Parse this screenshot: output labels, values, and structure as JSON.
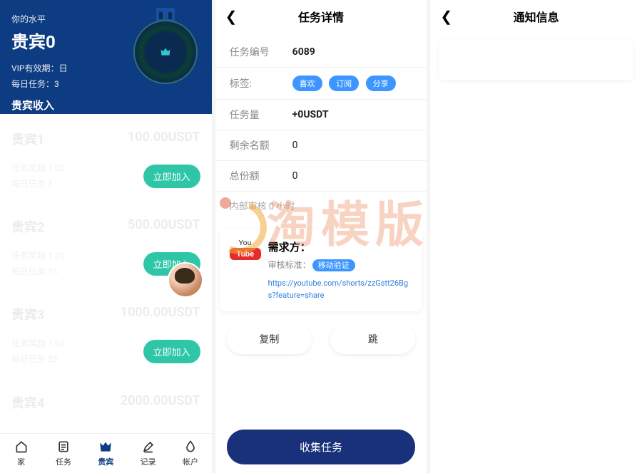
{
  "left": {
    "level_label": "你的水平",
    "level_name": "贵宾0",
    "vip_expiry_label": "VIP有效期：",
    "vip_expiry_value": "日",
    "daily_task_label": "每日任务：",
    "daily_task_value": "3",
    "income_label": "贵宾收入",
    "cards": [
      {
        "name": "贵宾1",
        "price": "100.00USDT",
        "row_a": "任务奖励  1.00",
        "row_b": "每日任务  3",
        "btn": "立即加入"
      },
      {
        "name": "贵宾2",
        "price": "500.00USDT",
        "row_a": "任务奖励  1.20",
        "row_b": "每日任务  15",
        "btn": "立即加入"
      },
      {
        "name": "贵宾3",
        "price": "1000.00USDT",
        "row_a": "任务奖励  1.60",
        "row_b": "每日任务  25",
        "btn": "立即加入"
      },
      {
        "name": "贵宾4",
        "price": "2000.00USDT",
        "row_a": "",
        "row_b": "",
        "btn": ""
      }
    ],
    "tabs": [
      {
        "label": "家"
      },
      {
        "label": "任务"
      },
      {
        "label": "贵宾"
      },
      {
        "label": "记录"
      },
      {
        "label": "帐户"
      }
    ]
  },
  "mid": {
    "title": "任务详情",
    "rows": {
      "id_k": "任务编号",
      "id_v": "6089",
      "tag_k": "标签:",
      "tags": [
        "喜欢",
        "订阅",
        "分享"
      ],
      "amt_k": "任务量",
      "amt_v": "+0USDT",
      "left_k": "剩余名额",
      "left_v": "0",
      "total_k": "总份额",
      "total_v": "0"
    },
    "note": "内部审核 0 小时",
    "req": {
      "yt_top": "You",
      "yt_box": "Tube",
      "title": "需求方：",
      "sub_label": "审核标准：",
      "sub_pill": "移动验证",
      "link": "https://youtube.com/shorts/zzGstt26Bgs?feature=share"
    },
    "btn_copy": "复制",
    "btn_jump": "跳",
    "btn_collect": "收集任务"
  },
  "right": {
    "title": "通知信息"
  },
  "watermark": "淘模版"
}
